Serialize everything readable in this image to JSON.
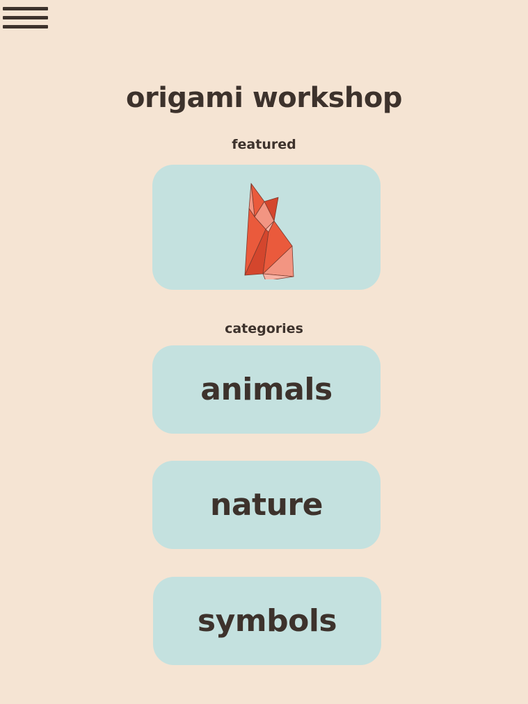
{
  "header": {
    "menu_icon": "hamburger-menu-icon",
    "title": "origami workshop"
  },
  "featured": {
    "label": "featured",
    "icon": "origami-fox-icon",
    "colors": {
      "primary": "#ea5a3c",
      "light": "#f29582",
      "pale": "#f7b3a5",
      "dark": "#d4462d"
    }
  },
  "categories": {
    "label": "categories",
    "items": [
      {
        "label": "animals"
      },
      {
        "label": "nature"
      },
      {
        "label": "symbols"
      }
    ]
  },
  "theme": {
    "background": "#f5e4d3",
    "card": "#c4e1df",
    "text": "#3d322c"
  }
}
